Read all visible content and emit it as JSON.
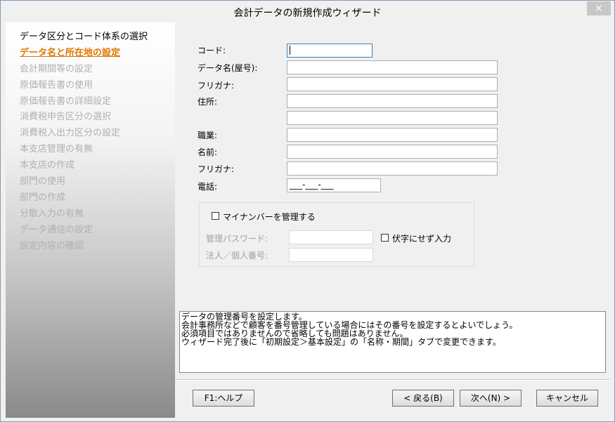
{
  "window": {
    "title": "会計データの新規作成ウィザード",
    "close_icon": "×"
  },
  "steps": [
    {
      "label": "データ区分とコード体系の選択",
      "state": "done"
    },
    {
      "label": "データ名と所在地の設定",
      "state": "active"
    },
    {
      "label": "会計期間等の設定",
      "state": "pending"
    },
    {
      "label": "原価報告書の使用",
      "state": "pending"
    },
    {
      "label": "原価報告書の詳細設定",
      "state": "pending"
    },
    {
      "label": "消費税申告区分の選択",
      "state": "pending"
    },
    {
      "label": "消費税入出力区分の設定",
      "state": "pending"
    },
    {
      "label": "本支店管理の有無",
      "state": "pending"
    },
    {
      "label": "本支店の作成",
      "state": "pending"
    },
    {
      "label": "部門の使用",
      "state": "pending"
    },
    {
      "label": "部門の作成",
      "state": "pending"
    },
    {
      "label": "分散入力の有無",
      "state": "pending"
    },
    {
      "label": "データ通信の設定",
      "state": "pending"
    },
    {
      "label": "設定内容の確認",
      "state": "pending"
    }
  ],
  "form": {
    "code_label": "コード:",
    "code_value": "",
    "name_label": "データ名(屋号):",
    "name_value": "",
    "furigana1_label": "フリガナ:",
    "furigana1_value": "",
    "address_label": "住所:",
    "address1_value": "",
    "address2_value": "",
    "occupation_label": "職業:",
    "occupation_value": "",
    "person_label": "名前:",
    "person_value": "",
    "furigana2_label": "フリガナ:",
    "furigana2_value": "",
    "phone_label": "電話:",
    "phone_value": "___-___-___"
  },
  "mynumber": {
    "checkbox_label": "マイナンバーを管理する",
    "password_label": "管理パスワード:",
    "mask_checkbox_label": "伏字にせず入力",
    "corp_number_label": "法人／個人番号:"
  },
  "help": {
    "lines": [
      "データの管理番号を設定します。",
      "会計事務所などで顧客を番号管理している場合にはその番号を設定するとよいでしょう。",
      "必須項目ではありませんので省略しても問題はありません。",
      "ウィザード完了後に「初期設定＞基本設定」の「名称・期間」タブで変更できます。"
    ]
  },
  "buttons": {
    "help": "F1:ヘルプ",
    "back": "< 戻る(B)",
    "next": "次へ(N) >",
    "cancel": "キャンセル"
  },
  "colors": {
    "active_step": "#e07800",
    "pending_step": "#b0b0b0",
    "focus_border": "#3c7fb1"
  }
}
